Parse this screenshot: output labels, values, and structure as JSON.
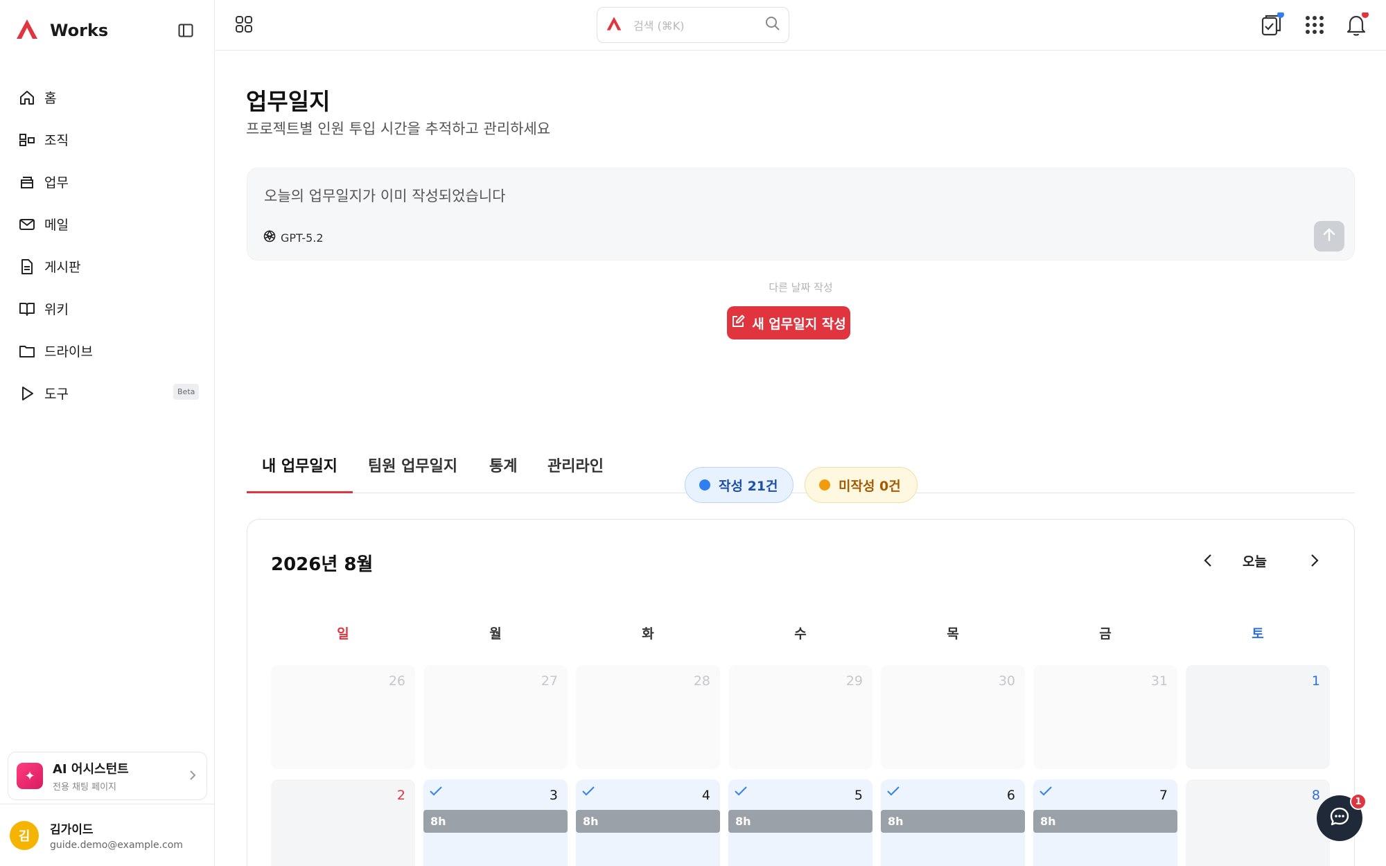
{
  "sidebar": {
    "brand": "Works",
    "items": [
      {
        "label": "홈",
        "icon": "home-icon"
      },
      {
        "label": "조직",
        "icon": "org-icon"
      },
      {
        "label": "업무",
        "icon": "tray-icon"
      },
      {
        "label": "메일",
        "icon": "mail-icon"
      },
      {
        "label": "게시판",
        "icon": "document-icon"
      },
      {
        "label": "위키",
        "icon": "book-icon"
      },
      {
        "label": "드라이브",
        "icon": "folder-icon"
      },
      {
        "label": "도구",
        "icon": "play-icon",
        "badge": "Beta"
      }
    ],
    "ai_card": {
      "title": "AI 어시스턴트",
      "subtitle": "전용 채팅 페이지"
    },
    "user": {
      "initial": "김",
      "name": "김가이드",
      "email": "guide.demo@example.com"
    }
  },
  "topbar": {
    "search_placeholder": "검색 (⌘K)"
  },
  "page": {
    "title": "업무일지",
    "subtitle": "프로젝트별 인원 투입 시간을 추적하고 관리하세요",
    "composer_text": "오늘의 업무일지가 이미 작성되었습니다",
    "model_label": "GPT-5.2",
    "other_day_label": "다른 날짜 작성",
    "new_button_label": "새 업무일지 작성"
  },
  "tabs": [
    "내 업무일지",
    "팀원 업무일지",
    "통계",
    "관리라인"
  ],
  "summary": {
    "written": "작성 21건",
    "unwritten": "미작성 0건"
  },
  "calendar": {
    "title": "2026년 8월",
    "today_label": "오늘",
    "weekdays": [
      "일",
      "월",
      "화",
      "수",
      "목",
      "금",
      "토"
    ],
    "week1": [
      "26",
      "27",
      "28",
      "29",
      "30",
      "31",
      "1"
    ],
    "week2": [
      "2",
      "3",
      "4",
      "5",
      "6",
      "7",
      "8"
    ],
    "hours": "8h"
  },
  "chat": {
    "badge": "1"
  },
  "colors": {
    "accent": "#e0343f",
    "sunday": "#e0343f",
    "saturday": "#2f6fdb",
    "written_bg": "#e8f2fe",
    "written_dot": "#2f7ff0",
    "unwritten_bg": "#fff8e1",
    "unwritten_dot": "#f29b0c"
  }
}
